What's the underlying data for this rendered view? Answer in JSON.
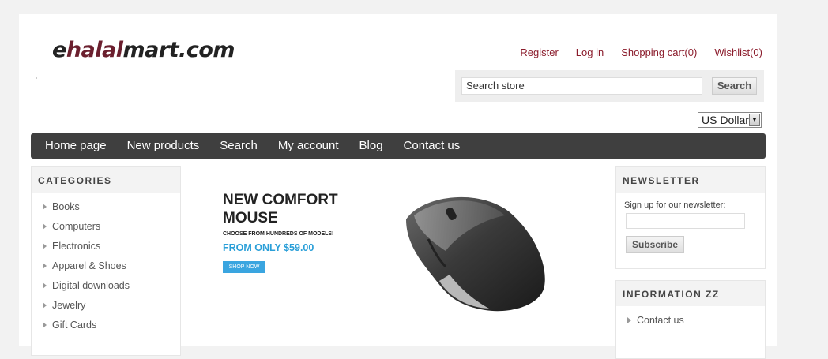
{
  "logo": {
    "part1": "e",
    "part2": "halal",
    "part3": "mart.com"
  },
  "header_links": [
    "Register",
    "Log in",
    "Shopping cart(0)",
    "Wishlist(0)"
  ],
  "search": {
    "placeholder": "Search store",
    "button_label": "Search"
  },
  "currency": {
    "selected": "US Dollar"
  },
  "nav": [
    "Home page",
    "New products",
    "Search",
    "My account",
    "Blog",
    "Contact us"
  ],
  "categories": {
    "title": "CATEGORIES",
    "items": [
      "Books",
      "Computers",
      "Electronics",
      "Apparel & Shoes",
      "Digital downloads",
      "Jewelry",
      "Gift Cards"
    ]
  },
  "banner": {
    "title_line1": "NEW COMFORT",
    "title_line2": "MOUSE",
    "subtitle": "CHOOSE FROM HUNDREDS OF MODELS!",
    "price": "FROM ONLY $59.00",
    "cta": "SHOP NOW"
  },
  "newsletter": {
    "title": "NEWSLETTER",
    "label": "Sign up for our newsletter:",
    "button_label": "Subscribe"
  },
  "information": {
    "title": "INFORMATION ZZ",
    "items": [
      "Contact us"
    ]
  },
  "colors": {
    "link": "#8b1c2c",
    "nav_bg": "#3f3f3f",
    "banner_accent": "#2a9fd8"
  }
}
